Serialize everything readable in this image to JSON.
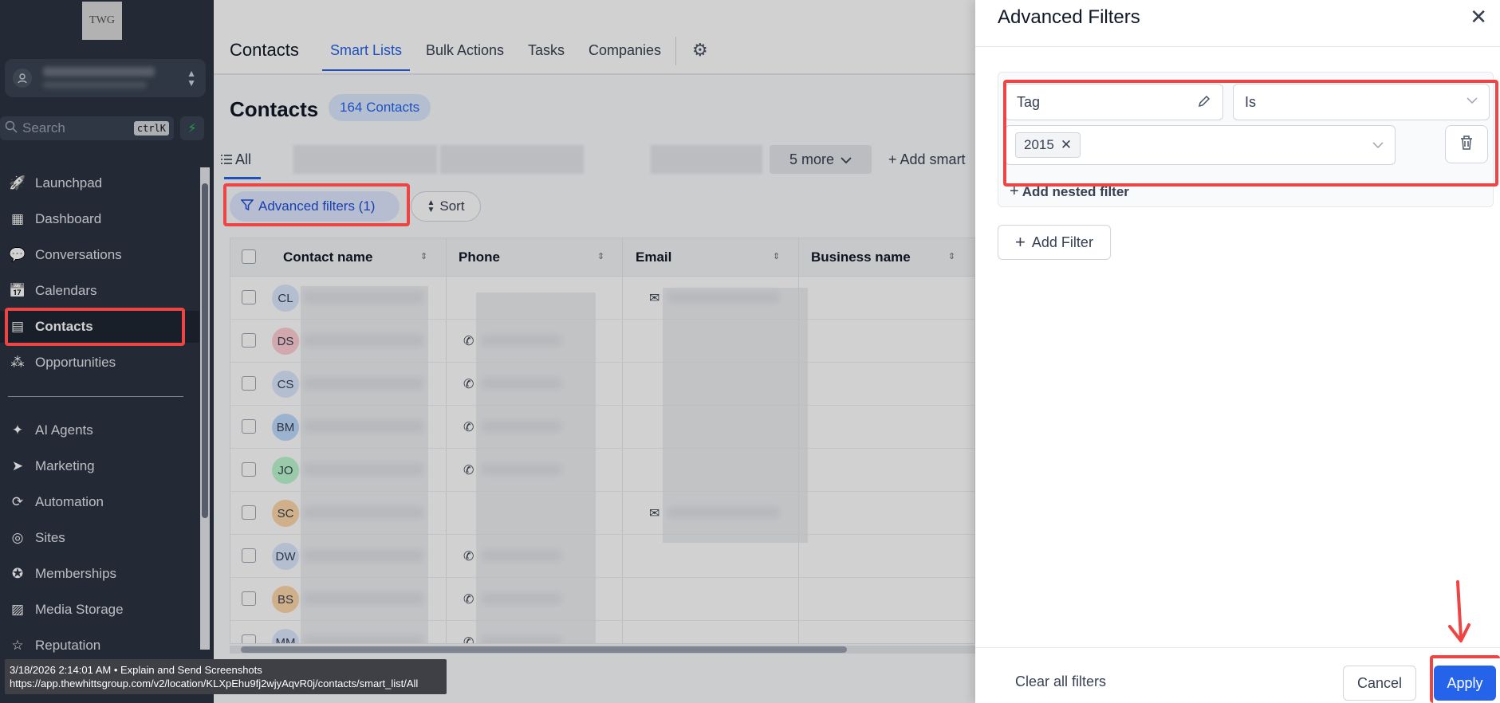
{
  "sidebar": {
    "logo_text": "TWG",
    "search": {
      "placeholder": "Search",
      "shortcut": "ctrlK"
    },
    "items": [
      {
        "label": "Launchpad",
        "icon": "rocket-icon"
      },
      {
        "label": "Dashboard",
        "icon": "dashboard-icon"
      },
      {
        "label": "Conversations",
        "icon": "chat-icon"
      },
      {
        "label": "Calendars",
        "icon": "calendar-icon"
      },
      {
        "label": "Contacts",
        "icon": "contacts-icon",
        "active": true
      },
      {
        "label": "Opportunities",
        "icon": "pipeline-icon"
      },
      {
        "label": "AI Agents",
        "icon": "sparkle-icon"
      },
      {
        "label": "Marketing",
        "icon": "send-icon"
      },
      {
        "label": "Automation",
        "icon": "automation-icon"
      },
      {
        "label": "Sites",
        "icon": "globe-icon"
      },
      {
        "label": "Memberships",
        "icon": "award-icon"
      },
      {
        "label": "Media Storage",
        "icon": "image-icon"
      },
      {
        "label": "Reputation",
        "icon": "star-icon"
      }
    ]
  },
  "topbar": {
    "title": "Contacts",
    "tabs": [
      "Smart Lists",
      "Bulk Actions",
      "Tasks",
      "Companies"
    ],
    "active_tab": "Smart Lists"
  },
  "page": {
    "title": "Contacts",
    "count": "164 Contacts"
  },
  "list_tabs": {
    "all": "All",
    "more": "5 more",
    "add": "Add smart"
  },
  "toolbar": {
    "advanced_filters": "Advanced filters (1)",
    "sort": "Sort"
  },
  "table": {
    "columns": [
      "Contact name",
      "Phone",
      "Email",
      "Business name"
    ],
    "rows": [
      {
        "initials": "CL",
        "color": "#dbeafe",
        "phone": false,
        "email": true
      },
      {
        "initials": "DS",
        "color": "#fecdd3",
        "phone": true,
        "email": false
      },
      {
        "initials": "CS",
        "color": "#dbeafe",
        "phone": true,
        "email": false
      },
      {
        "initials": "BM",
        "color": "#bfdbfe",
        "phone": true,
        "email": false
      },
      {
        "initials": "JO",
        "color": "#bbf7d0",
        "phone": true,
        "email": false
      },
      {
        "initials": "SC",
        "color": "#fed7aa",
        "phone": false,
        "email": true
      },
      {
        "initials": "DW",
        "color": "#dbeafe",
        "phone": true,
        "email": false
      },
      {
        "initials": "BS",
        "color": "#fed7aa",
        "phone": true,
        "email": false
      },
      {
        "initials": "MM",
        "color": "#dbeafe",
        "phone": true,
        "email": false
      }
    ]
  },
  "status_tooltip": {
    "line1": "3/18/2026 2:14:01 AM • Explain and Send Screenshots",
    "line2": "https://app.thewhittsgroup.com/v2/location/KLXpEhu9fj2wjyAqvR0j/contacts/smart_list/All"
  },
  "drawer": {
    "title": "Advanced Filters",
    "filter": {
      "field": "Tag",
      "operator": "Is",
      "value_chip": "2015"
    },
    "add_nested": "Add nested filter",
    "add_filter": "Add Filter",
    "clear_all": "Clear all filters",
    "cancel": "Cancel",
    "apply": "Apply"
  },
  "colors": {
    "accent": "#2563eb",
    "sidebar_bg": "#2b3442",
    "annotation": "#ef4444"
  }
}
